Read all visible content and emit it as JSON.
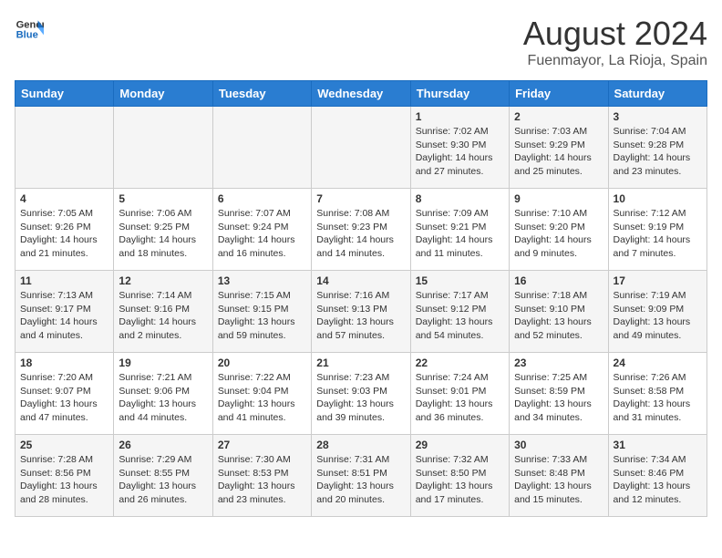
{
  "header": {
    "logo_general": "General",
    "logo_blue": "Blue",
    "month_year": "August 2024",
    "location": "Fuenmayor, La Rioja, Spain"
  },
  "days_of_week": [
    "Sunday",
    "Monday",
    "Tuesday",
    "Wednesday",
    "Thursday",
    "Friday",
    "Saturday"
  ],
  "weeks": [
    [
      {
        "day": "",
        "content": ""
      },
      {
        "day": "",
        "content": ""
      },
      {
        "day": "",
        "content": ""
      },
      {
        "day": "",
        "content": ""
      },
      {
        "day": "1",
        "content": "Sunrise: 7:02 AM\nSunset: 9:30 PM\nDaylight: 14 hours\nand 27 minutes."
      },
      {
        "day": "2",
        "content": "Sunrise: 7:03 AM\nSunset: 9:29 PM\nDaylight: 14 hours\nand 25 minutes."
      },
      {
        "day": "3",
        "content": "Sunrise: 7:04 AM\nSunset: 9:28 PM\nDaylight: 14 hours\nand 23 minutes."
      }
    ],
    [
      {
        "day": "4",
        "content": "Sunrise: 7:05 AM\nSunset: 9:26 PM\nDaylight: 14 hours\nand 21 minutes."
      },
      {
        "day": "5",
        "content": "Sunrise: 7:06 AM\nSunset: 9:25 PM\nDaylight: 14 hours\nand 18 minutes."
      },
      {
        "day": "6",
        "content": "Sunrise: 7:07 AM\nSunset: 9:24 PM\nDaylight: 14 hours\nand 16 minutes."
      },
      {
        "day": "7",
        "content": "Sunrise: 7:08 AM\nSunset: 9:23 PM\nDaylight: 14 hours\nand 14 minutes."
      },
      {
        "day": "8",
        "content": "Sunrise: 7:09 AM\nSunset: 9:21 PM\nDaylight: 14 hours\nand 11 minutes."
      },
      {
        "day": "9",
        "content": "Sunrise: 7:10 AM\nSunset: 9:20 PM\nDaylight: 14 hours\nand 9 minutes."
      },
      {
        "day": "10",
        "content": "Sunrise: 7:12 AM\nSunset: 9:19 PM\nDaylight: 14 hours\nand 7 minutes."
      }
    ],
    [
      {
        "day": "11",
        "content": "Sunrise: 7:13 AM\nSunset: 9:17 PM\nDaylight: 14 hours\nand 4 minutes."
      },
      {
        "day": "12",
        "content": "Sunrise: 7:14 AM\nSunset: 9:16 PM\nDaylight: 14 hours\nand 2 minutes."
      },
      {
        "day": "13",
        "content": "Sunrise: 7:15 AM\nSunset: 9:15 PM\nDaylight: 13 hours\nand 59 minutes."
      },
      {
        "day": "14",
        "content": "Sunrise: 7:16 AM\nSunset: 9:13 PM\nDaylight: 13 hours\nand 57 minutes."
      },
      {
        "day": "15",
        "content": "Sunrise: 7:17 AM\nSunset: 9:12 PM\nDaylight: 13 hours\nand 54 minutes."
      },
      {
        "day": "16",
        "content": "Sunrise: 7:18 AM\nSunset: 9:10 PM\nDaylight: 13 hours\nand 52 minutes."
      },
      {
        "day": "17",
        "content": "Sunrise: 7:19 AM\nSunset: 9:09 PM\nDaylight: 13 hours\nand 49 minutes."
      }
    ],
    [
      {
        "day": "18",
        "content": "Sunrise: 7:20 AM\nSunset: 9:07 PM\nDaylight: 13 hours\nand 47 minutes."
      },
      {
        "day": "19",
        "content": "Sunrise: 7:21 AM\nSunset: 9:06 PM\nDaylight: 13 hours\nand 44 minutes."
      },
      {
        "day": "20",
        "content": "Sunrise: 7:22 AM\nSunset: 9:04 PM\nDaylight: 13 hours\nand 41 minutes."
      },
      {
        "day": "21",
        "content": "Sunrise: 7:23 AM\nSunset: 9:03 PM\nDaylight: 13 hours\nand 39 minutes."
      },
      {
        "day": "22",
        "content": "Sunrise: 7:24 AM\nSunset: 9:01 PM\nDaylight: 13 hours\nand 36 minutes."
      },
      {
        "day": "23",
        "content": "Sunrise: 7:25 AM\nSunset: 8:59 PM\nDaylight: 13 hours\nand 34 minutes."
      },
      {
        "day": "24",
        "content": "Sunrise: 7:26 AM\nSunset: 8:58 PM\nDaylight: 13 hours\nand 31 minutes."
      }
    ],
    [
      {
        "day": "25",
        "content": "Sunrise: 7:28 AM\nSunset: 8:56 PM\nDaylight: 13 hours\nand 28 minutes."
      },
      {
        "day": "26",
        "content": "Sunrise: 7:29 AM\nSunset: 8:55 PM\nDaylight: 13 hours\nand 26 minutes."
      },
      {
        "day": "27",
        "content": "Sunrise: 7:30 AM\nSunset: 8:53 PM\nDaylight: 13 hours\nand 23 minutes."
      },
      {
        "day": "28",
        "content": "Sunrise: 7:31 AM\nSunset: 8:51 PM\nDaylight: 13 hours\nand 20 minutes."
      },
      {
        "day": "29",
        "content": "Sunrise: 7:32 AM\nSunset: 8:50 PM\nDaylight: 13 hours\nand 17 minutes."
      },
      {
        "day": "30",
        "content": "Sunrise: 7:33 AM\nSunset: 8:48 PM\nDaylight: 13 hours\nand 15 minutes."
      },
      {
        "day": "31",
        "content": "Sunrise: 7:34 AM\nSunset: 8:46 PM\nDaylight: 13 hours\nand 12 minutes."
      }
    ]
  ]
}
